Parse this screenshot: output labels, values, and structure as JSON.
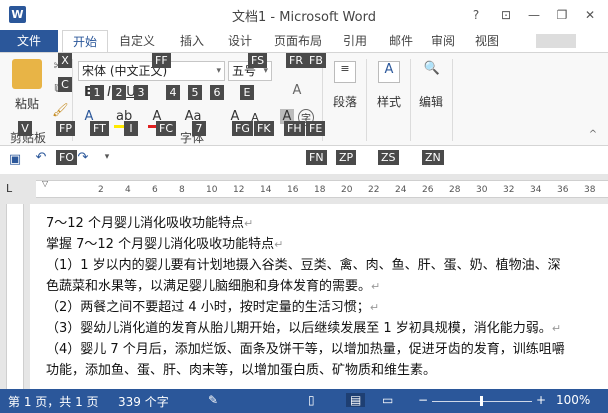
{
  "window": {
    "title": "文档1 - Microsoft Word",
    "help": "?",
    "ribbon_display": "⊡",
    "minimize": "—",
    "restore": "❐",
    "close": "✕"
  },
  "tabs": [
    {
      "label": "文件"
    },
    {
      "label": "开始"
    },
    {
      "label": "自定义"
    },
    {
      "label": "插入"
    },
    {
      "label": "设计"
    },
    {
      "label": "页面布局"
    },
    {
      "label": "引用"
    },
    {
      "label": "邮件"
    },
    {
      "label": "审阅"
    },
    {
      "label": "视图"
    }
  ],
  "ribbon": {
    "font_name": "宋体 (中文正文)",
    "font_size": "五号",
    "paste_label": "粘贴",
    "clipboard_label": "剪贴板",
    "font_group_label": "字体",
    "paragraph_label": "段落",
    "styles_label": "样式",
    "editing_label": "编辑"
  },
  "keytips": {
    "cut": "X",
    "font_name": "FF",
    "font_size": "FS",
    "grow": "FG",
    "shrink": "FK",
    "fr": "FR",
    "fb": "FB",
    "change_case": "7",
    "clear": "E",
    "bold": "1",
    "italic": "2",
    "underline": "3",
    "strike": "4",
    "sub": "5",
    "sup": "6",
    "paste": "V",
    "format_painter": "FP",
    "text_effects": "FT",
    "highlight": "I",
    "font_color": "FC",
    "char_shading": "FH",
    "enclose": "FE",
    "fo": "FO",
    "fn": "FN",
    "zp": "ZP",
    "zs": "ZS",
    "zn": "ZN",
    "c_copy": "C"
  },
  "ruler_ticks": [
    "2",
    "4",
    "6",
    "8",
    "10",
    "12",
    "14",
    "16",
    "18",
    "20",
    "22",
    "24",
    "26",
    "28",
    "30",
    "32",
    "34",
    "36",
    "38"
  ],
  "ruler_corner": "L",
  "document": {
    "lines": [
      "7～12 个月婴儿消化吸收功能特点",
      "掌握 7～12 个月婴儿消化吸收功能特点",
      "（1）1 岁以内的婴儿要有计划地摄入谷类、豆类、禽、肉、鱼、肝、蛋、奶、植物油、深",
      "色蔬菜和水果等，以满足婴儿脑细胞和身体发育的需要。",
      "（2）两餐之间不要超过 4 小时，按时定量的生活习惯；",
      "（3）婴幼儿消化道的发育从胎儿期开始，以后继续发展至 1 岁初具规模，消化能力弱。",
      "（4）婴儿 7 个月后，添加烂饭、面条及饼干等，以增加热量，促进牙齿的发育，训练咀嚼",
      "功能，添加鱼、蛋、肝、肉末等，以增加蛋白质、矿物质和维生素。"
    ],
    "para_mark": "↵"
  },
  "status": {
    "page": "第 1 页，共 1 页",
    "words": "339 个字",
    "zoom": "100%"
  },
  "colors": {
    "brand": "#2b579a",
    "keytip_bg": "#4a4a4a"
  }
}
